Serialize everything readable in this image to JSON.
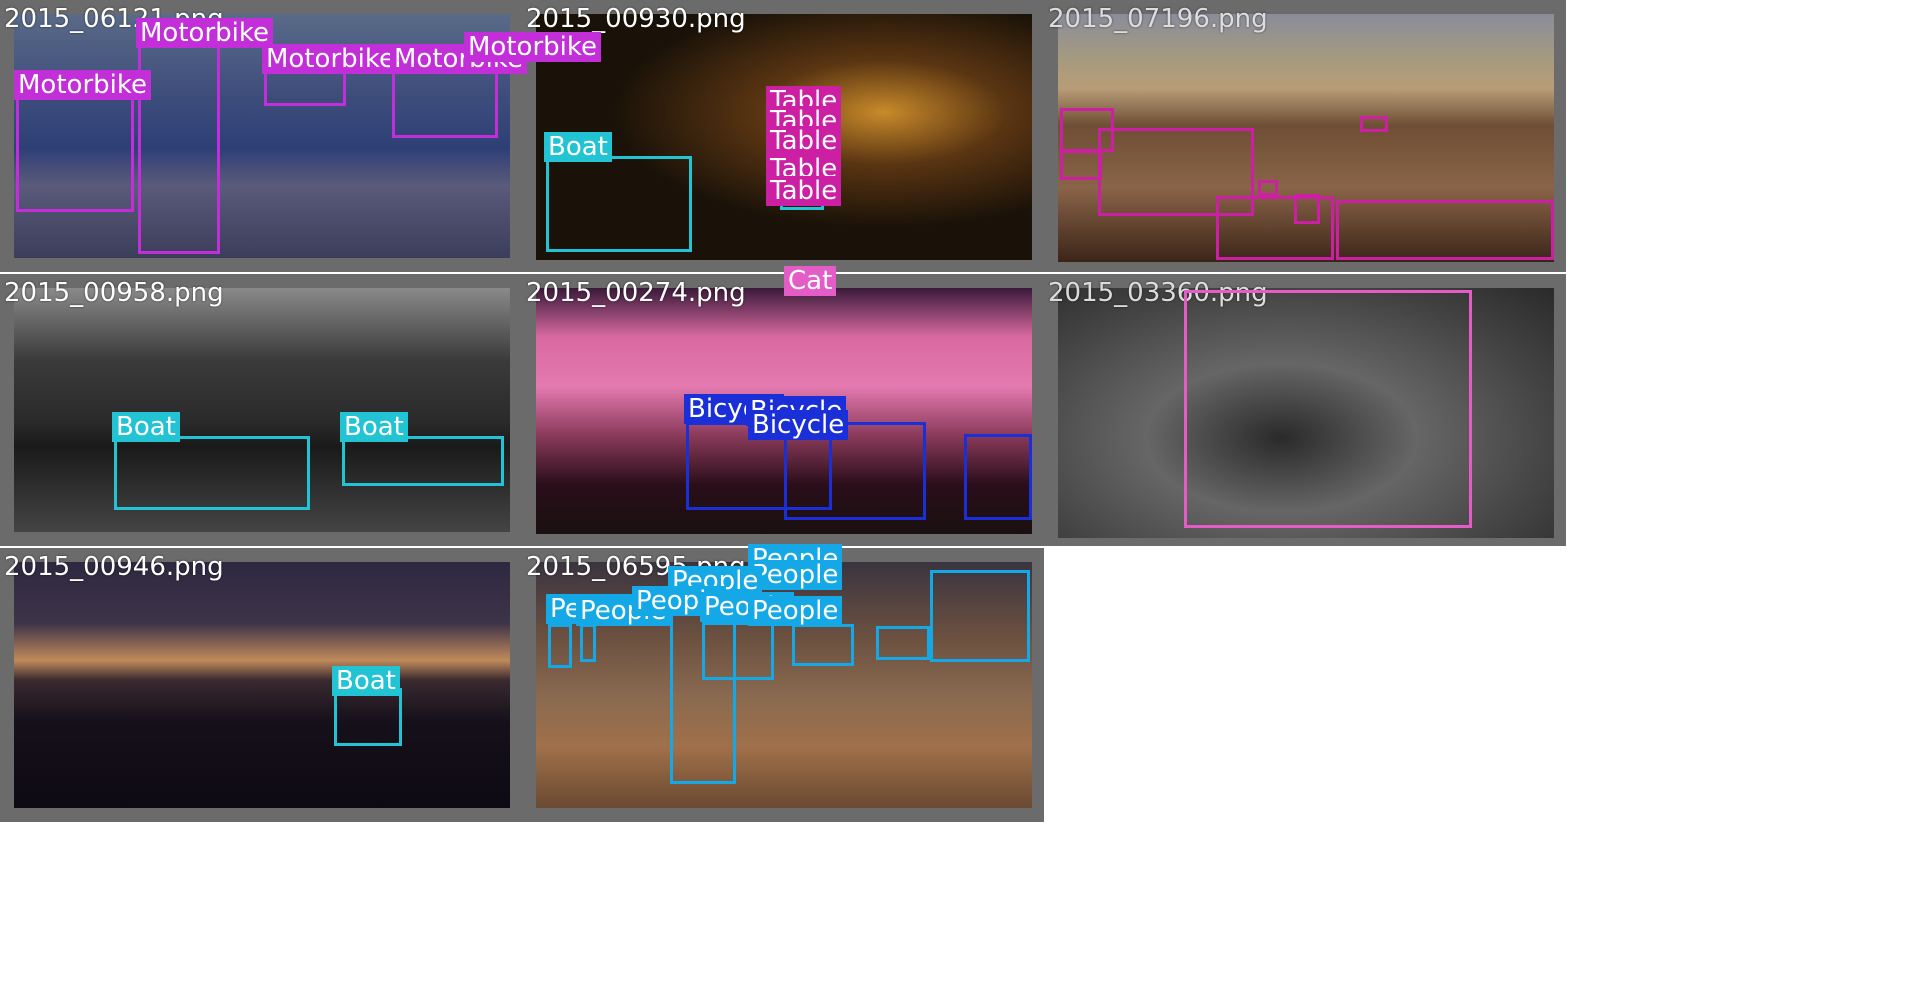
{
  "colors": {
    "motorbike": "#c22ed8",
    "table": "#cc1fa3",
    "boat": "#22c4d4",
    "cat": "#e45cc6",
    "bicycle": "#1b2fd8",
    "people": "#14a8e6"
  },
  "tiles": [
    {
      "filename": "2015_06121.png",
      "labels": [
        "Motorbike",
        "Motorbike",
        "Motorbike",
        "Motorbike",
        "Motorbike"
      ]
    },
    {
      "filename": "2015_00930.png",
      "labels": [
        "Boat",
        "Table",
        "Table",
        "Table",
        "Table",
        "Table"
      ]
    },
    {
      "filename": "2015_07196.png",
      "labels": []
    },
    {
      "filename": "2015_00958.png",
      "labels": [
        "Boat",
        "Boat"
      ]
    },
    {
      "filename": "2015_00274.png",
      "labels": [
        "Cat",
        "Bicycle",
        "Bicycle",
        "Bicycle"
      ]
    },
    {
      "filename": "2015_03360.png",
      "labels": []
    },
    {
      "filename": "2015_00946.png",
      "labels": [
        "Boat"
      ]
    },
    {
      "filename": "2015_06595.png",
      "labels": [
        "People",
        "People",
        "People",
        "People",
        "People",
        "People",
        "People",
        "People"
      ]
    }
  ]
}
